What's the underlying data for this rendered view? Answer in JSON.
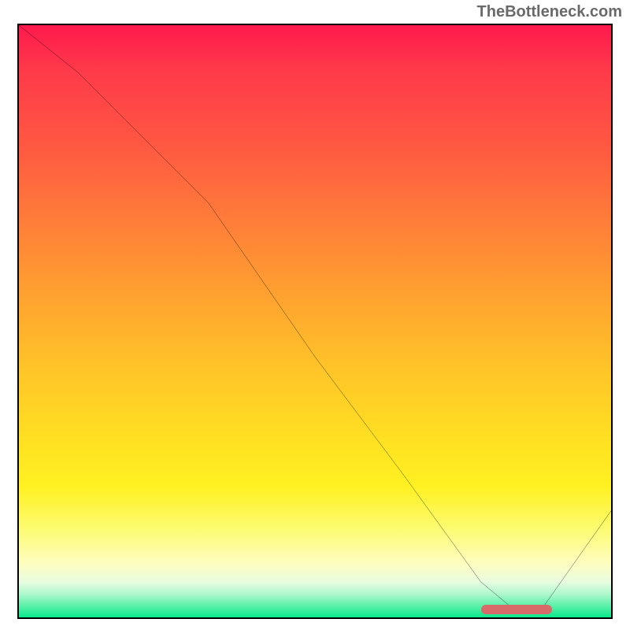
{
  "watermark": "TheBottleneck.com",
  "chart_data": {
    "type": "line",
    "title": "",
    "xlabel": "",
    "ylabel": "",
    "xlim": [
      0,
      100
    ],
    "ylim": [
      0,
      100
    ],
    "grid": false,
    "legend": false,
    "background_gradient": {
      "top_color": "#ff1a4d",
      "bottom_color": "#08e98b",
      "description": "red-orange-yellow-green vertical heat gradient"
    },
    "series": [
      {
        "name": "bottleneck-curve",
        "color": "#000000",
        "x": [
          0,
          10,
          22,
          32,
          50,
          65,
          78,
          84,
          88,
          100
        ],
        "values": [
          100,
          92,
          80,
          70,
          44,
          24,
          6,
          1,
          1,
          18
        ]
      }
    ],
    "annotations": [
      {
        "name": "optimal-range",
        "type": "bar-marker",
        "color": "#d96a6a",
        "x_start": 78,
        "x_end": 90,
        "y": 1
      }
    ]
  }
}
